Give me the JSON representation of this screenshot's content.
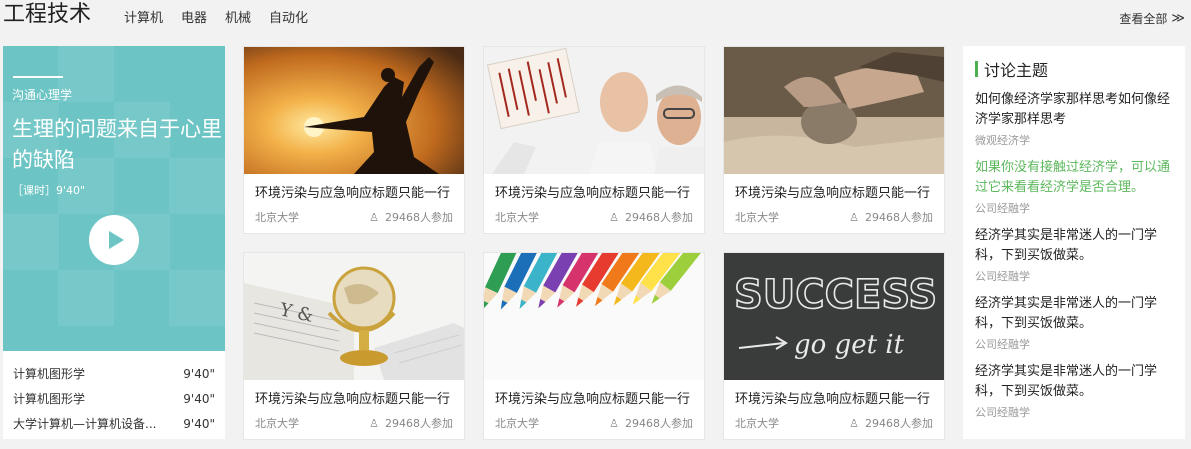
{
  "header": {
    "title": "工程技术",
    "nav": [
      "计算机",
      "电器",
      "机械",
      "自动化"
    ],
    "view_all": "查看全部",
    "view_all_chevron": "≫"
  },
  "featured": {
    "category": "沟通心理学",
    "headline": "生理的问题来自于心里的缺陷",
    "duration": "［课时］9'40\"",
    "banner_color": "#6dc4c4",
    "lessons": [
      {
        "name": "计算机图形学",
        "time": "9'40\""
      },
      {
        "name": "计算机图形学",
        "time": "9'40\""
      },
      {
        "name": "大学计算机—计算机设备...",
        "time": "9'40\""
      }
    ]
  },
  "cards": [
    {
      "title": "环境污染与应急响应标题只能一行",
      "school": "北京大学",
      "participants": "29468人参加",
      "image": "silhouette-sunset"
    },
    {
      "title": "环境污染与应急响应标题只能一行",
      "school": "北京大学",
      "participants": "29468人参加",
      "image": "scientists-gel"
    },
    {
      "title": "环境污染与应急响应标题只能一行",
      "school": "北京大学",
      "participants": "29468人参加",
      "image": "clay-hands"
    },
    {
      "title": "环境污染与应急响应标题只能一行",
      "school": "北京大学",
      "participants": "29468人参加",
      "image": "globe-newspaper"
    },
    {
      "title": "环境污染与应急响应标题只能一行",
      "school": "北京大学",
      "participants": "29468人参加",
      "image": "colored-pencils"
    },
    {
      "title": "环境污染与应急响应标题只能一行",
      "school": "北京大学",
      "participants": "29468人参加",
      "image": "chalkboard-success"
    }
  ],
  "discussion": {
    "title": "讨论主题",
    "accent": "#4caf50",
    "topics": [
      {
        "text": "如何像经济学家那样思考如何像经济学家那样思考",
        "tag": "微观经济学",
        "highlight": false
      },
      {
        "text": "如果你没有接触过经济学，可以通过它来看看经济学是否合理。",
        "tag": "公司经融学",
        "highlight": true
      },
      {
        "text": "经济学其实是非常迷人的一门学科，下到买饭做菜。",
        "tag": "公司经融学",
        "highlight": false
      },
      {
        "text": "经济学其实是非常迷人的一门学科，下到买饭做菜。",
        "tag": "公司经融学",
        "highlight": false
      },
      {
        "text": "经济学其实是非常迷人的一门学科，下到买饭做菜。",
        "tag": "公司经融学",
        "highlight": false
      }
    ]
  },
  "chalkboard": {
    "line1": "SUCCESS",
    "line2": "go get it"
  }
}
